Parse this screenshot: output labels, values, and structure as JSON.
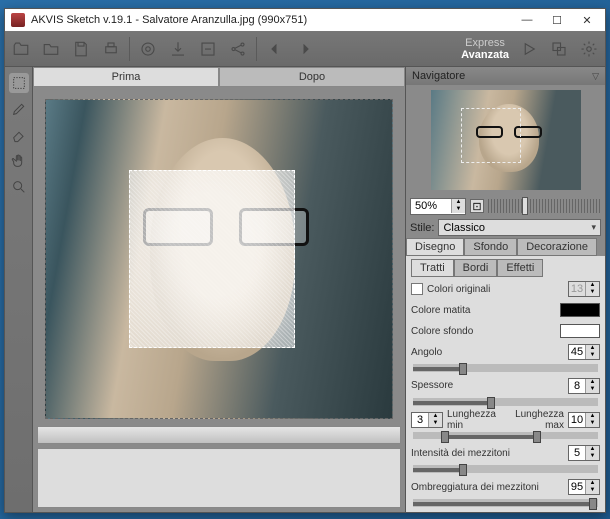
{
  "title": "AKVIS Sketch v.19.1 - Salvatore Aranzulla.jpg (990x751)",
  "modes": {
    "express": "Express",
    "advanced": "Avanzata"
  },
  "tabs": {
    "before": "Prima",
    "after": "Dopo"
  },
  "navigator": {
    "title": "Navigatore",
    "zoom": "50%"
  },
  "style": {
    "label": "Stile:",
    "value": "Classico"
  },
  "mainTabs": {
    "disegno": "Disegno",
    "sfondo": "Sfondo",
    "decorazione": "Decorazione"
  },
  "innerTabs": {
    "tratti": "Tratti",
    "bordi": "Bordi",
    "effetti": "Effetti"
  },
  "settings": {
    "originalColors": {
      "label": "Colori originali",
      "value": "13"
    },
    "pencilColor": {
      "label": "Colore matita",
      "hex": "#000000"
    },
    "bgColor": {
      "label": "Colore sfondo",
      "hex": "#ffffff"
    },
    "angle": {
      "label": "Angolo",
      "value": "45"
    },
    "thickness": {
      "label": "Spessore",
      "value": "8"
    },
    "minLen": {
      "label": "Lunghezza min",
      "startValue": "3"
    },
    "maxLen": {
      "label": "Lunghezza max",
      "value": "10"
    },
    "midtones": {
      "label": "Intensità dei mezzitoni",
      "value": "5"
    },
    "shading": {
      "label": "Ombreggiatura dei mezzitoni",
      "value": "95"
    }
  }
}
